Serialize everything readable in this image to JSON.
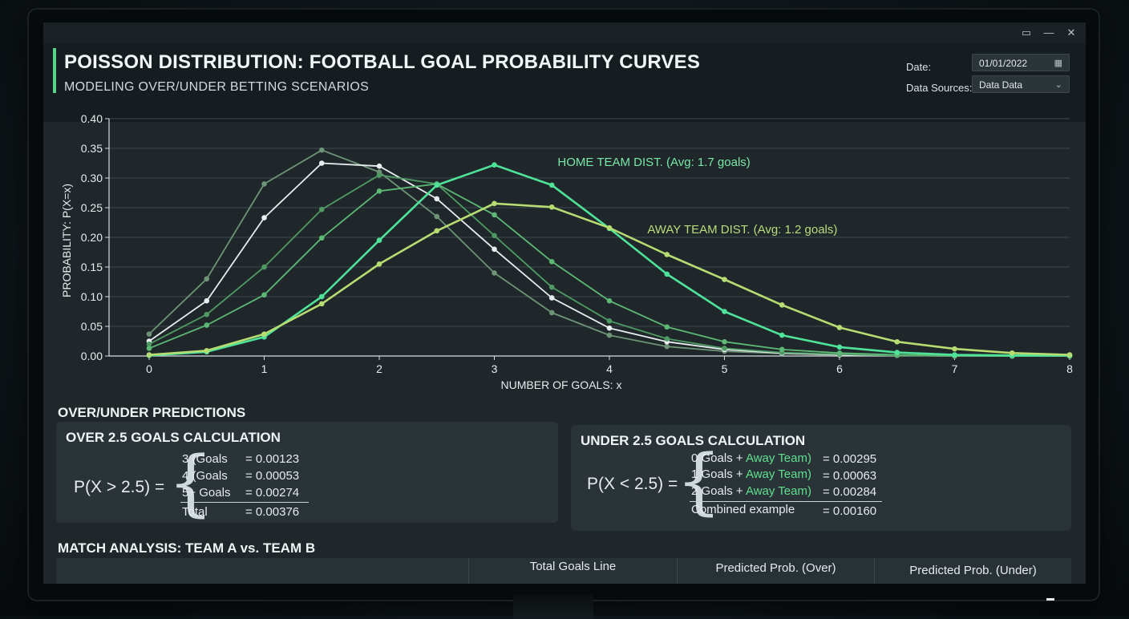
{
  "window": {
    "controls": [
      {
        "name": "restore-icon",
        "glyph": "▭"
      },
      {
        "name": "minimize-icon",
        "glyph": "—"
      },
      {
        "name": "close-icon",
        "glyph": "✕"
      }
    ]
  },
  "header": {
    "title": "POISSON DISTRIBUTION: FOOTBALL GOAL PROBABILITY CURVES",
    "subtitle": "MODELING OVER/UNDER BETTING SCENARIOS",
    "date_label": "Date:",
    "date_value": "01/01/2022",
    "date_icon": "calendar-icon",
    "source_label": "Data Sources:",
    "source_value": "Data Data",
    "source_icon": "chevron-down-icon"
  },
  "chart_data": {
    "type": "line",
    "title": "",
    "xlabel": "NUMBER OF GOALS: x",
    "ylabel": "PROBABILITY: P(X=x)",
    "xlim": [
      0,
      8
    ],
    "ylim": [
      0,
      0.4
    ],
    "x_ticks": [
      "0",
      "1",
      "2",
      "3",
      "4",
      "5",
      "6",
      "7",
      "8"
    ],
    "y_ticks": [
      "0.00",
      "0.05",
      "0.10",
      "0.15",
      "0.20",
      "0.25",
      "0.30",
      "0.35",
      "0.40"
    ],
    "grid": true,
    "x": [
      0,
      0.5,
      1,
      1.5,
      2,
      2.5,
      3,
      3.5,
      4,
      4.5,
      5,
      5.5,
      6,
      6.5,
      7,
      7.5,
      8
    ],
    "series": [
      {
        "color": "#6e9477",
        "values": [
          0.037,
          0.13,
          0.29,
          0.347,
          0.31,
          0.235,
          0.14,
          0.073,
          0.035,
          0.016,
          0.008,
          0.004,
          0.002,
          0.001,
          0.0,
          0.0,
          0.0
        ]
      },
      {
        "color": "#e8eef0",
        "values": [
          0.025,
          0.093,
          0.233,
          0.325,
          0.32,
          0.265,
          0.18,
          0.098,
          0.047,
          0.024,
          0.011,
          0.005,
          0.002,
          0.001,
          0.0,
          0.0,
          0.0
        ]
      },
      {
        "color": "#4f9a63",
        "values": [
          0.02,
          0.07,
          0.15,
          0.247,
          0.305,
          0.29,
          0.203,
          0.116,
          0.059,
          0.029,
          0.013,
          0.006,
          0.003,
          0.001,
          0.0,
          0.0,
          0.0
        ]
      },
      {
        "color": "#5cb874",
        "values": [
          0.013,
          0.052,
          0.103,
          0.199,
          0.278,
          0.29,
          0.238,
          0.159,
          0.093,
          0.049,
          0.024,
          0.011,
          0.005,
          0.002,
          0.001,
          0.0,
          0.0
        ]
      },
      {
        "name": "HOME TEAM DIST. (Avg: 1.7 goals)",
        "color": "#4fe39a",
        "values": [
          0.001,
          0.007,
          0.032,
          0.1,
          0.195,
          0.288,
          0.322,
          0.288,
          0.215,
          0.138,
          0.075,
          0.035,
          0.015,
          0.006,
          0.002,
          0.001,
          0.001
        ]
      },
      {
        "name": "AWAY TEAM DIST. (Avg: 1.2 goals)",
        "color": "#b7dc72",
        "values": [
          0.002,
          0.009,
          0.037,
          0.088,
          0.155,
          0.211,
          0.257,
          0.251,
          0.216,
          0.171,
          0.129,
          0.086,
          0.048,
          0.024,
          0.012,
          0.005,
          0.002
        ]
      }
    ],
    "annotations": [
      {
        "text": "HOME TEAM DIST. (Avg: 1.7 goals)",
        "color": "#79e8a6",
        "x": 3.55,
        "y": 0.32
      },
      {
        "text": "AWAY TEAM DIST. (Avg: 1.2 goals)",
        "color": "#b9dc7c",
        "x": 4.33,
        "y": 0.207
      }
    ]
  },
  "predictions": {
    "section_title": "OVER/UNDER PREDICTIONS",
    "over": {
      "title": "OVER 2.5 GOALS CALCULATION",
      "lhs": "P(X > 2.5) =",
      "rows": [
        {
          "term": "3 (Goals",
          "value": "= 0.00123"
        },
        {
          "term": "4 (Goals",
          "value": "= 0.00053"
        },
        {
          "term": "5+ Goals",
          "value": "= 0.00274"
        }
      ],
      "total_term": "Total",
      "total_value": "= 0.00376"
    },
    "under": {
      "title": "UNDER 2.5 GOALS CALCULATION",
      "lhs": "P(X < 2.5) =",
      "rows": [
        {
          "term": "0 Goals + ",
          "term_green": "Away Team)",
          "value": "= 0.00295"
        },
        {
          "term": "1 Goals + ",
          "term_green": "Away Team)",
          "value": "= 0.00063"
        },
        {
          "term": "2 Goals + ",
          "term_green": "Away Team)",
          "value": "= 0.00284"
        }
      ],
      "total_term": "Combined example",
      "total_value": "= 0.00160"
    }
  },
  "match": {
    "section_title": "MATCH ANALYSIS: TEAM A vs. TEAM B",
    "columns": [
      "",
      "Total Goals Line",
      "Predicted Prob. (Over)",
      "Predicted Prob. (Under)"
    ]
  }
}
